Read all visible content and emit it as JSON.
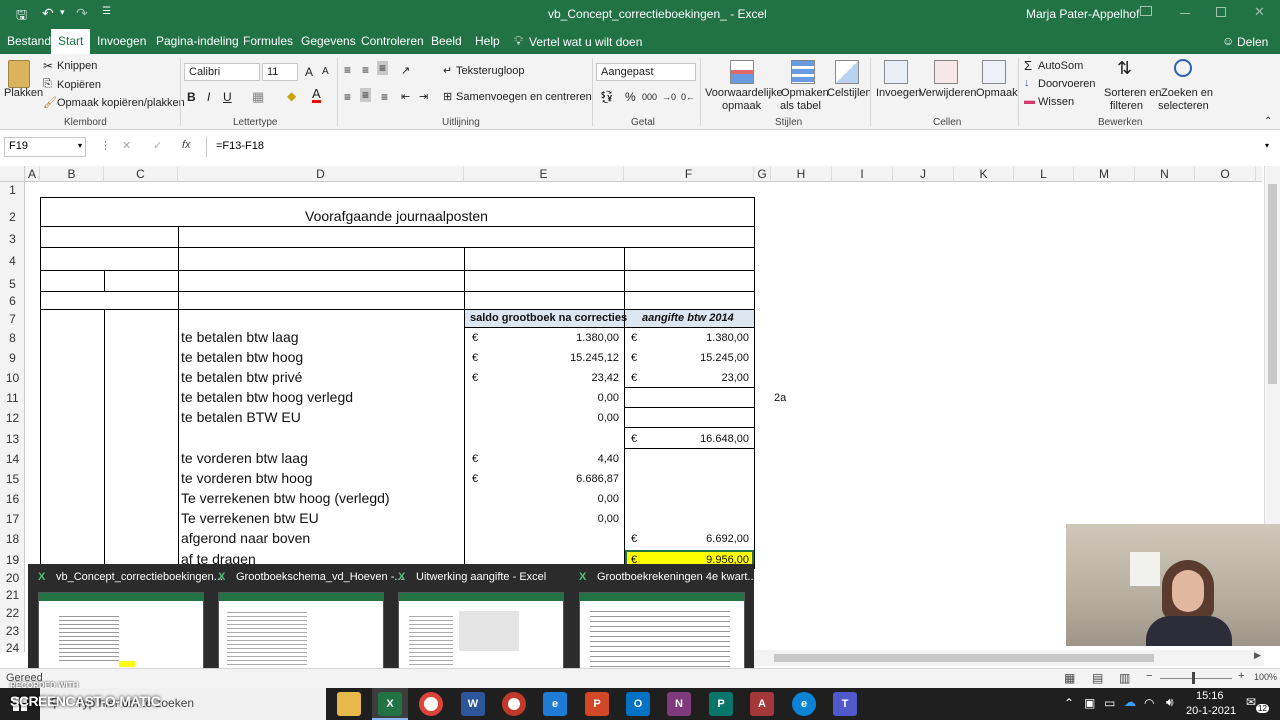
{
  "window": {
    "title": "vb_Concept_correctieboekingen_ - Excel",
    "user": "Marja Pater-Appelhof"
  },
  "menu": {
    "tabs": [
      "Bestand",
      "Start",
      "Invoegen",
      "Pagina-indeling",
      "Formules",
      "Gegevens",
      "Controleren",
      "Beeld",
      "Help"
    ],
    "tell_me": "Vertel wat u wilt doen",
    "share": "Delen"
  },
  "ribbon": {
    "clipboard": {
      "paste": "Plakken",
      "cut": "Knippen",
      "copy": "Kopiëren",
      "format_painter": "Opmaak kopiëren/plakken",
      "group": "Klembord"
    },
    "font": {
      "name": "Calibri",
      "size": "11",
      "bold": "B",
      "italic": "I",
      "underline": "U",
      "grow": "A",
      "shrink": "A",
      "color_letter": "A",
      "group": "Lettertype"
    },
    "alignment": {
      "wrap": "Teksterugloop",
      "merge": "Samenvoegen en centreren",
      "group": "Uitlijning"
    },
    "number": {
      "format": "Aangepast",
      "percent": "%",
      "thousands": "000",
      "group": "Getal"
    },
    "styles": {
      "conditional_1": "Voorwaardelijke",
      "conditional_2": "opmaak",
      "table_1": "Opmaken",
      "table_2": "als tabel",
      "cell_styles": "Celstijlen",
      "group": "Stijlen"
    },
    "cells": {
      "insert": "Invoegen",
      "delete": "Verwijderen",
      "format": "Opmaak",
      "group": "Cellen"
    },
    "editing": {
      "autosum": "AutoSom",
      "fill": "Doorvoeren",
      "clear": "Wissen",
      "sort_1": "Sorteren en",
      "sort_2": "filteren",
      "find_1": "Zoeken en",
      "find_2": "selecteren",
      "group": "Bewerken"
    }
  },
  "formula_bar": {
    "name_box": "F19",
    "fx": "fx",
    "formula": "=F13-F18"
  },
  "sheet": {
    "columns": [
      "A",
      "B",
      "C",
      "D",
      "E",
      "F",
      "G",
      "H",
      "I",
      "J",
      "K",
      "L",
      "M",
      "N",
      "O"
    ],
    "rows": [
      "1",
      "2",
      "3",
      "4",
      "5",
      "6",
      "7",
      "8",
      "9",
      "10",
      "11",
      "12",
      "13",
      "14",
      "15",
      "16",
      "17",
      "18",
      "19",
      "20",
      "21",
      "22",
      "23",
      "24"
    ],
    "title": "Voorafgaande journaalposten",
    "header_e": "saldo grootboek na correcties",
    "header_f": "aangifte btw 2014",
    "euro": "€",
    "h11": "2a",
    "lines": [
      {
        "label": "te betalen btw laag",
        "e": "1.380,00",
        "e_euro": true,
        "f": "1.380,00",
        "f_euro": true
      },
      {
        "label": "te betalen btw hoog",
        "e": "15.245,12",
        "e_euro": true,
        "f": "15.245,00",
        "f_euro": true
      },
      {
        "label": "te betalen btw privé",
        "e": "23,42",
        "e_euro": true,
        "f": "23,00",
        "f_euro": true
      },
      {
        "label": "te betalen btw hoog verlegd",
        "e": "0,00",
        "e_euro": false,
        "f": "",
        "f_euro": false
      },
      {
        "label": "te betalen BTW EU",
        "e": "0,00",
        "e_euro": false,
        "f": "",
        "f_euro": false
      },
      {
        "label": "",
        "e": "",
        "e_euro": false,
        "f": "16.648,00",
        "f_euro": true
      },
      {
        "label": "te vorderen btw laag",
        "e": "4,40",
        "e_euro": true,
        "f": "",
        "f_euro": false
      },
      {
        "label": "te vorderen btw hoog",
        "e": "6.686,87",
        "e_euro": true,
        "f": "",
        "f_euro": false
      },
      {
        "label": "Te verrekenen btw hoog (verlegd)",
        "e": "0,00",
        "e_euro": false,
        "f": "",
        "f_euro": false
      },
      {
        "label": "Te verrekenen btw EU",
        "e": "0,00",
        "e_euro": false,
        "f": "",
        "f_euro": false
      },
      {
        "label": "afgerond naar boven",
        "e": "",
        "e_euro": false,
        "f": "6.692,00",
        "f_euro": true
      },
      {
        "label": "af te dragen",
        "e": "",
        "e_euro": false,
        "f": "9.956,00",
        "f_euro": true
      }
    ]
  },
  "thumbnails": [
    {
      "title": "vb_Concept_correctieboekingen..."
    },
    {
      "title": "Grootboekschema_vd_Hoeven -..."
    },
    {
      "title": "Uitwerking aangifte - Excel"
    },
    {
      "title": "Grootboekrekeningen 4e kwart..."
    }
  ],
  "status_bar": {
    "ready": "Gereed",
    "zoom": "100%"
  },
  "watermark": {
    "recorded": "RECORDED WITH",
    "brand": "SCREENCAST-O-MATIC"
  },
  "taskbar": {
    "search_placeholder": "Typ hier om te zoeken",
    "time": "15:16",
    "date": "20-1-2021",
    "notifications": "12"
  },
  "colors": {
    "excel_green": "#217346",
    "highlight_yellow": "#ffff00",
    "header_fill": "#dce6f1"
  }
}
